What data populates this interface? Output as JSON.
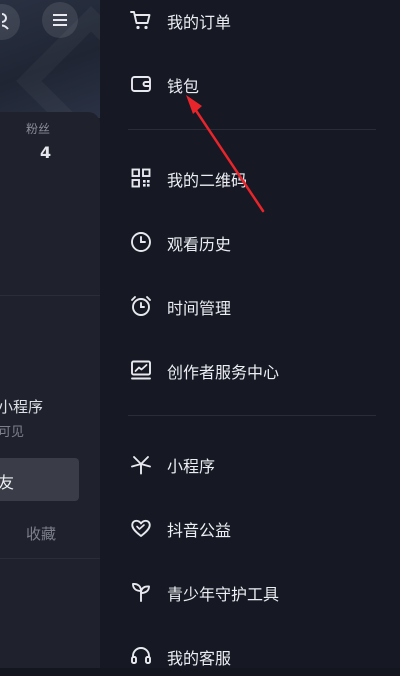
{
  "background": {
    "fans_label": "粉丝",
    "fans_count": "4",
    "mini_program_label": "小程序",
    "mini_program_sub": "可见",
    "friend_button_label": "友",
    "favorites_label": "收藏"
  },
  "drawer": {
    "items": [
      {
        "label": "我的订单",
        "icon": "cart-icon"
      },
      {
        "label": "钱包",
        "icon": "wallet-icon"
      },
      {
        "label": "我的二维码",
        "icon": "qr-code-icon"
      },
      {
        "label": "观看历史",
        "icon": "clock-icon"
      },
      {
        "label": "时间管理",
        "icon": "alarm-clock-icon"
      },
      {
        "label": "创作者服务中心",
        "icon": "creator-chart-icon"
      },
      {
        "label": "小程序",
        "icon": "mini-program-icon"
      },
      {
        "label": "抖音公益",
        "icon": "charity-heart-icon"
      },
      {
        "label": "青少年守护工具",
        "icon": "sprout-icon"
      },
      {
        "label": "我的客服",
        "icon": "headset-icon"
      }
    ]
  },
  "colors": {
    "drawer_bg": "#161823",
    "annotation_arrow": "#e8252b"
  }
}
